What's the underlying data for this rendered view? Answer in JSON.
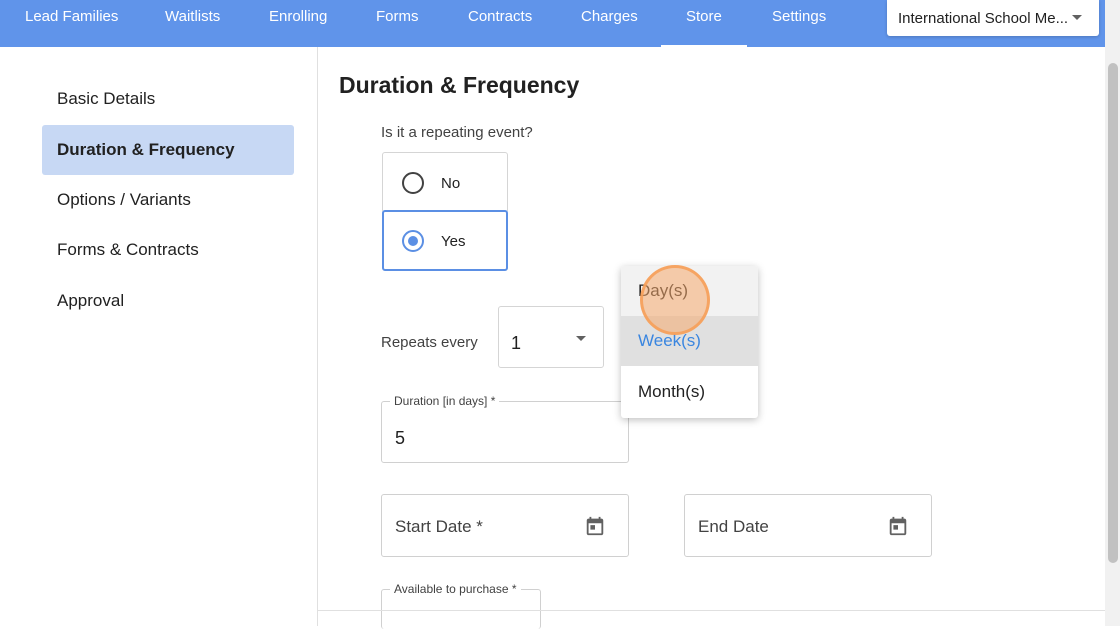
{
  "topnav": {
    "items": [
      "Lead Families",
      "Waitlists",
      "Enrolling",
      "Forms",
      "Contracts",
      "Charges",
      "Store",
      "Settings"
    ],
    "active": "Store",
    "school_select": "International School Me..."
  },
  "sidebar": {
    "items": [
      "Basic Details",
      "Duration & Frequency",
      "Options / Variants",
      "Forms & Contracts",
      "Approval"
    ],
    "active": "Duration & Frequency"
  },
  "main": {
    "title": "Duration & Frequency",
    "repeating_question": "Is it a repeating event?",
    "options": [
      {
        "label": "No",
        "selected": false
      },
      {
        "label": "Yes",
        "selected": true
      }
    ],
    "repeats_label": "Repeats every",
    "repeats_value": "1",
    "duration_label": "Duration [in days] *",
    "duration_value": "5",
    "start_date_label": "Start Date *",
    "end_date_label": "End Date",
    "available_label": "Available to purchase *"
  },
  "dropdown": {
    "items": [
      "Day(s)",
      "Week(s)",
      "Month(s)"
    ],
    "selected": "Week(s)",
    "hovered": "Day(s)"
  },
  "colors": {
    "nav_bg": "#6094ea",
    "sidebar_active_bg": "#c7d8f4",
    "accent": "#5b8fe4",
    "menu_selected_text": "#3a86e0",
    "click_marker": "#f6a05a"
  },
  "icons": {
    "calendar": "calendar-icon",
    "caret": "caret-down-icon"
  }
}
